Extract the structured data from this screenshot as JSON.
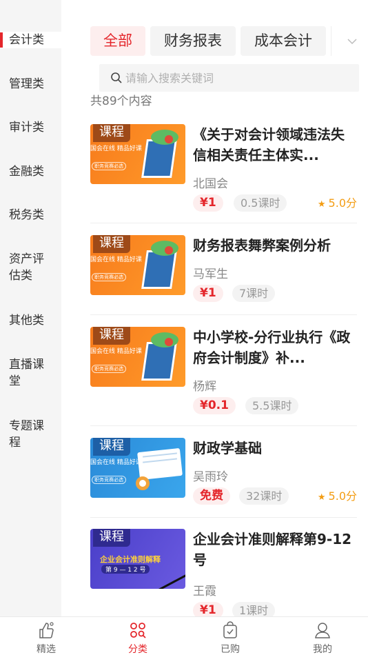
{
  "sidebar": {
    "items": [
      {
        "label": "会计类",
        "active": true
      },
      {
        "label": "管理类",
        "active": false
      },
      {
        "label": "审计类",
        "active": false
      },
      {
        "label": "金融类",
        "active": false
      },
      {
        "label": "税务类",
        "active": false
      },
      {
        "label": "资产评估类",
        "active": false
      },
      {
        "label": "其他类",
        "active": false
      },
      {
        "label": "直播课堂",
        "active": false
      },
      {
        "label": "专题课程",
        "active": false
      }
    ]
  },
  "tabs": [
    {
      "label": "全部",
      "active": true
    },
    {
      "label": "财务报表",
      "active": false
    },
    {
      "label": "成本会计",
      "active": false
    }
  ],
  "search": {
    "placeholder": "请输入搜索关键词",
    "value": ""
  },
  "result_count": "共89个内容",
  "thumb_text": {
    "tag": "课程",
    "slogan": "国会在线 精品好课",
    "pill": "职务竞赛必选"
  },
  "courses": [
    {
      "title": "《关于对会计领域违法失信相关责任主体实...",
      "author": "北国会",
      "price": "¥1",
      "hours": "0.5课时",
      "rating": "5.0分",
      "thumb_style": "orange"
    },
    {
      "title": "财务报表舞弊案例分析",
      "author": "马军生",
      "price": "¥1",
      "hours": "7课时",
      "rating": "",
      "thumb_style": "orange"
    },
    {
      "title": "中小学校-分行业执行《政府会计制度》补...",
      "author": "杨辉",
      "price": "¥0.1",
      "hours": "5.5课时",
      "rating": "",
      "thumb_style": "orange"
    },
    {
      "title": "财政学基础",
      "author": "吴雨玲",
      "price": "免费",
      "hours": "32课时",
      "rating": "5.0分",
      "thumb_style": "blue"
    },
    {
      "title": "企业会计准则解释第9-12号",
      "author": "王霞",
      "price": "¥1",
      "hours": "1课时",
      "rating": "",
      "thumb_style": "purple",
      "thumb_title": "企业会计准则解释",
      "thumb_sub": "第 9 — 1 2 号"
    }
  ],
  "bottom_nav": [
    {
      "label": "精选",
      "icon": "thumbs-up-icon",
      "active": false
    },
    {
      "label": "分类",
      "icon": "category-icon",
      "active": true
    },
    {
      "label": "已购",
      "icon": "bag-icon",
      "active": false
    },
    {
      "label": "我的",
      "icon": "user-icon",
      "active": false
    }
  ],
  "colors": {
    "accent": "#e4262b",
    "rating": "#f39c12"
  }
}
